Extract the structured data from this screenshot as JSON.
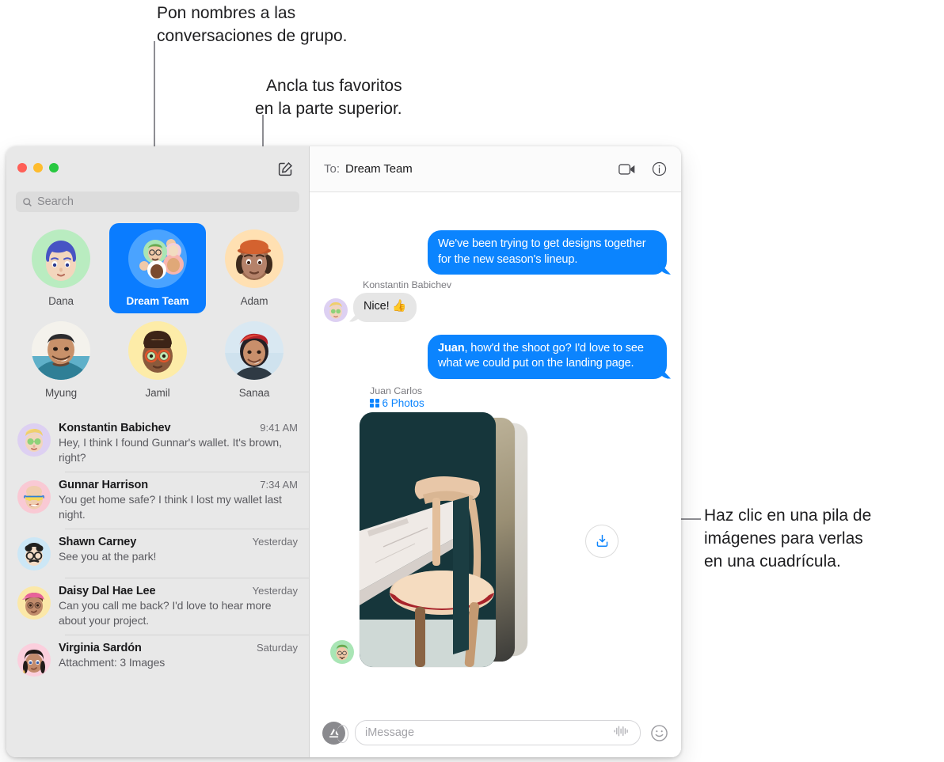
{
  "annotations": [
    {
      "id": "group-names",
      "text": "Pon nombres a las\nconversaciones de grupo."
    },
    {
      "id": "pin-favorites",
      "text": "Ancla tus favoritos\nen la parte superior."
    },
    {
      "id": "photo-stack",
      "text": "Haz clic en una pila de\nimágenes para verlas\nen una cuadrícula."
    }
  ],
  "window": {
    "traffic_lights": {
      "close": "close",
      "minimize": "minimize",
      "zoom": "zoom"
    }
  },
  "sidebar": {
    "compose_icon": "compose-icon",
    "search": {
      "placeholder": "Search",
      "icon": "search-icon",
      "value": ""
    },
    "pinned": [
      {
        "name": "Dana",
        "avatar": "dana",
        "selected": false
      },
      {
        "name": "Dream Team",
        "avatar": "dreamteam",
        "selected": true
      },
      {
        "name": "Adam",
        "avatar": "adam",
        "selected": false
      },
      {
        "name": "Myung",
        "avatar": "myung",
        "selected": false
      },
      {
        "name": "Jamil",
        "avatar": "jamil",
        "selected": false
      },
      {
        "name": "Sanaa",
        "avatar": "sanaa",
        "selected": false
      }
    ],
    "conversations": [
      {
        "name": "Konstantin Babichev",
        "time": "9:41 AM",
        "preview": "Hey, I think I found Gunnar's wallet. It's brown, right?",
        "avatar": "konstantin"
      },
      {
        "name": "Gunnar Harrison",
        "time": "7:34 AM",
        "preview": "You get home safe? I think I lost my wallet last night.",
        "avatar": "gunnar"
      },
      {
        "name": "Shawn Carney",
        "time": "Yesterday",
        "preview": "See you at the park!",
        "avatar": "shawn"
      },
      {
        "name": "Daisy Dal Hae Lee",
        "time": "Yesterday",
        "preview": "Can you call me back? I'd love to hear more about your project.",
        "avatar": "daisy"
      },
      {
        "name": "Virginia Sardón",
        "time": "Saturday",
        "preview": "Attachment: 3 Images",
        "avatar": "virginia"
      }
    ]
  },
  "thread": {
    "to_label": "To:",
    "to_name": "Dream Team",
    "facetime_icon": "video-camera-icon",
    "info_icon": "info-icon",
    "messages": [
      {
        "kind": "out",
        "text": "We've been trying to get designs together for the new season's lineup."
      },
      {
        "kind": "in",
        "sender": "Konstantin Babichev",
        "text": "Nice! 👍",
        "avatar": "konstantin"
      },
      {
        "kind": "out",
        "bold_prefix": "Juan",
        "text": ", how'd the shoot go? I'd love to see what we could put on the landing page."
      }
    ],
    "attachment": {
      "sender": "Juan Carlos",
      "count_label": "6 Photos",
      "grid_icon": "grid-icon",
      "download_icon": "download-icon",
      "avatar": "juan"
    },
    "composer": {
      "apps_icon": "app-store-icon",
      "placeholder": "iMessage",
      "value": "",
      "audio_icon": "audio-waveform-icon",
      "emoji_icon": "smiley-icon"
    }
  },
  "colors": {
    "accent_blue": "#0b84fe",
    "selected_pin": "#0a7cff",
    "sidebar_bg": "#e8e8e8",
    "incoming_bubble": "#e6e6e6",
    "traffic_red": "#ff5f57",
    "traffic_yellow": "#febc2e",
    "traffic_green": "#28c840"
  }
}
